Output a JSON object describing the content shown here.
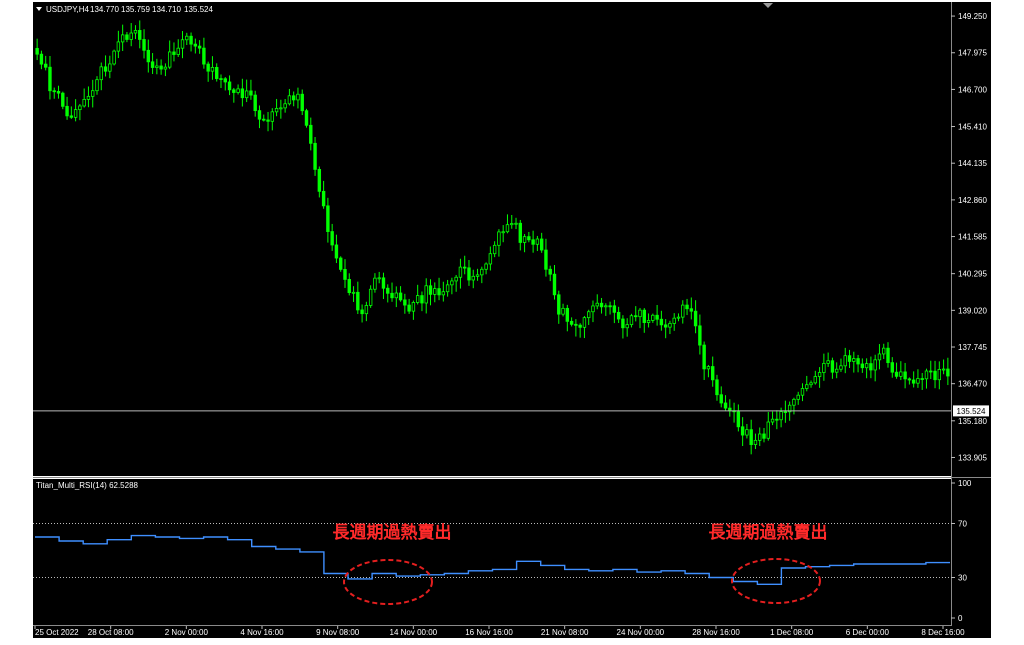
{
  "header": {
    "symbol": "USDJPY,H4",
    "open": "134.770",
    "high": "135.759",
    "low": "134.710",
    "close": "135.524",
    "current_price": "135.524"
  },
  "indicator": {
    "label": "Titan_Multi_RSI(14) 62.5288"
  },
  "annotations": [
    {
      "text": "長週期過熱賣出"
    },
    {
      "text": "長週期過熱賣出"
    }
  ],
  "colors": {
    "background": "#000000",
    "bull_candle": "#00ff00",
    "rsi_line": "#3f8fff",
    "annotation": "#ff2a2a",
    "grid": "#cfcfcf"
  },
  "chart_data": [
    {
      "type": "candlestick",
      "symbol": "USDJPY",
      "timeframe": "H4",
      "ylim": [
        133.4,
        149.6
      ],
      "y_ticks": [
        "149.250",
        "147.975",
        "146.700",
        "145.410",
        "144.135",
        "142.860",
        "141.585",
        "140.295",
        "139.020",
        "137.745",
        "136.470",
        "135.180",
        "133.905"
      ],
      "x_ticks": [
        "25 Oct 2022",
        "28 Oct 08:00",
        "2 Nov 00:00",
        "4 Nov 16:00",
        "9 Nov 08:00",
        "14 Nov 00:00",
        "16 Nov 16:00",
        "21 Nov 08:00",
        "24 Nov 00:00",
        "28 Nov 16:00",
        "1 Dec 08:00",
        "6 Dec 00:00",
        "8 Dec 16:00"
      ],
      "horizontal_line": 135.524,
      "close_path": [
        [
          "25 Oct 2022",
          148.2
        ],
        [
          "26 Oct",
          146.5
        ],
        [
          "27 Oct",
          145.9
        ],
        [
          "28 Oct 08:00",
          146.3
        ],
        [
          "29 Oct",
          147.4
        ],
        [
          "31 Oct",
          148.3
        ],
        [
          "1 Nov",
          148.9
        ],
        [
          "2 Nov 00:00",
          147.2
        ],
        [
          "3 Nov",
          147.7
        ],
        [
          "3 Nov 12:00",
          148.4
        ],
        [
          "4 Nov",
          147.9
        ],
        [
          "4 Nov 16:00",
          147.1
        ],
        [
          "7 Nov",
          146.5
        ],
        [
          "8 Nov",
          146.4
        ],
        [
          "8 Nov 12:00",
          145.6
        ],
        [
          "9 Nov 00:00",
          146.3
        ],
        [
          "9 Nov 08:00",
          146.6
        ],
        [
          "10 Nov",
          144.2
        ],
        [
          "10 Nov 12:00",
          141.4
        ],
        [
          "11 Nov",
          140.0
        ],
        [
          "11 Nov 12:00",
          138.9
        ],
        [
          "14 Nov 00:00",
          140.2
        ],
        [
          "14 Nov 12:00",
          139.5
        ],
        [
          "15 Nov",
          138.9
        ],
        [
          "15 Nov 12:00",
          139.8
        ],
        [
          "16 Nov 16:00",
          139.6
        ],
        [
          "17 Nov",
          140.4
        ],
        [
          "18 Nov",
          140.1
        ],
        [
          "19 Nov",
          141.3
        ],
        [
          "21 Nov 08:00",
          142.0
        ],
        [
          "22 Nov",
          141.5
        ],
        [
          "23 Nov",
          141.2
        ],
        [
          "23 Nov 12:00",
          139.2
        ],
        [
          "24 Nov 00:00",
          138.5
        ],
        [
          "24 Nov 12:00",
          138.8
        ],
        [
          "25 Nov",
          139.4
        ],
        [
          "26 Nov",
          138.5
        ],
        [
          "28 Nov 00:00",
          139.0
        ],
        [
          "28 Nov 16:00",
          138.6
        ],
        [
          "29 Nov",
          138.7
        ],
        [
          "29 Nov 12:00",
          139.3
        ],
        [
          "30 Nov",
          137.2
        ],
        [
          "30 Nov 12:00",
          136.0
        ],
        [
          "1 Dec 08:00",
          135.2
        ],
        [
          "1 Dec 16:00",
          134.4
        ],
        [
          "2 Dec",
          134.9
        ],
        [
          "2 Dec 12:00",
          135.6
        ],
        [
          "5 Dec",
          136.5
        ],
        [
          "5 Dec 12:00",
          136.9
        ],
        [
          "6 Dec 00:00",
          137.1
        ],
        [
          "6 Dec 12:00",
          137.4
        ],
        [
          "7 Dec",
          137.0
        ],
        [
          "7 Dec 12:00",
          137.5
        ],
        [
          "8 Dec",
          136.7
        ],
        [
          "8 Dec 16:00",
          136.4
        ],
        [
          "9 Dec",
          136.8
        ],
        [
          "9 Dec 12:00",
          136.7
        ]
      ]
    },
    {
      "type": "line",
      "name": "Titan_Multi_RSI(14)",
      "ylim": [
        0,
        100
      ],
      "y_ticks": [
        100,
        70,
        30,
        0
      ],
      "levels": [
        70,
        30
      ],
      "last_value": 62.5288,
      "step_values": [
        60,
        57,
        55,
        58,
        61,
        60,
        59,
        60,
        58,
        53,
        51,
        49,
        33,
        29,
        33,
        31,
        32,
        33,
        35,
        36,
        42,
        39,
        36,
        35,
        36,
        34,
        35,
        33,
        30,
        27,
        25,
        37,
        38,
        39,
        40,
        40,
        40,
        41
      ]
    }
  ]
}
